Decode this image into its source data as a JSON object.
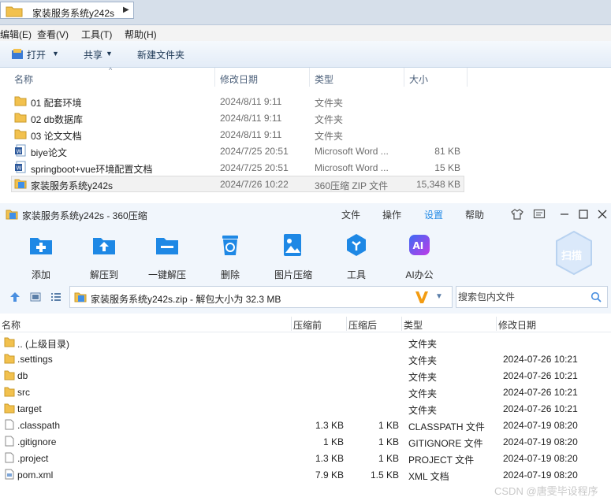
{
  "explorer": {
    "address": "家装服务系统y242s",
    "menu": [
      "编辑(E)",
      "查看(V)",
      "工具(T)",
      "帮助(H)"
    ],
    "toolbar": {
      "open": "打开",
      "share": "共享",
      "new_folder": "新建文件夹"
    },
    "columns": {
      "name": "名称",
      "date": "修改日期",
      "type": "类型",
      "size": "大小"
    },
    "rows": [
      {
        "name": "01 配套环境",
        "date": "2024/8/11 9:11",
        "type": "文件夹",
        "size": "",
        "icon": "folder-icon"
      },
      {
        "name": "02 db数据库",
        "date": "2024/8/11 9:11",
        "type": "文件夹",
        "size": "",
        "icon": "folder-icon"
      },
      {
        "name": "03 论文文档",
        "date": "2024/8/11 9:11",
        "type": "文件夹",
        "size": "",
        "icon": "folder-icon"
      },
      {
        "name": "biye论文",
        "date": "2024/7/25 20:51",
        "type": "Microsoft Word ...",
        "size": "81 KB",
        "icon": "word-icon"
      },
      {
        "name": "springboot+vue环境配置文档",
        "date": "2024/7/25 20:51",
        "type": "Microsoft Word ...",
        "size": "15 KB",
        "icon": "word-icon"
      },
      {
        "name": "家装服务系统y242s",
        "date": "2024/7/26 10:22",
        "type": "360压缩 ZIP 文件",
        "size": "15,348 KB",
        "icon": "zip-icon"
      }
    ]
  },
  "zip": {
    "title": "家装服务系统y242s - 360压缩",
    "menu": [
      "文件",
      "操作",
      "设置",
      "帮助"
    ],
    "active_menu": "设置",
    "ribbon": [
      "添加",
      "解压到",
      "一键解压",
      "删除",
      "图片压缩",
      "工具",
      "AI办公"
    ],
    "scan": "扫描",
    "path": "家装服务系统y242s.zip - 解包大小为 32.3 MB",
    "search_placeholder": "搜索包内文件",
    "columns": {
      "name": "名称",
      "compressed_before": "压缩前",
      "compressed_after": "压缩后",
      "type": "类型",
      "date": "修改日期"
    },
    "rows": [
      {
        "name": ".. (上级目录)",
        "before": "",
        "after": "",
        "type": "文件夹",
        "date": "",
        "icon": "folder-icon"
      },
      {
        "name": ".settings",
        "before": "",
        "after": "",
        "type": "文件夹",
        "date": "2024-07-26 10:21",
        "icon": "folder-icon"
      },
      {
        "name": "db",
        "before": "",
        "after": "",
        "type": "文件夹",
        "date": "2024-07-26 10:21",
        "icon": "folder-icon"
      },
      {
        "name": "src",
        "before": "",
        "after": "",
        "type": "文件夹",
        "date": "2024-07-26 10:21",
        "icon": "folder-icon"
      },
      {
        "name": "target",
        "before": "",
        "after": "",
        "type": "文件夹",
        "date": "2024-07-26 10:21",
        "icon": "folder-icon"
      },
      {
        "name": ".classpath",
        "before": "1.3 KB",
        "after": "1 KB",
        "type": "CLASSPATH 文件",
        "date": "2024-07-19 08:20",
        "icon": "file-icon"
      },
      {
        "name": ".gitignore",
        "before": "1 KB",
        "after": "1 KB",
        "type": "GITIGNORE 文件",
        "date": "2024-07-19 08:20",
        "icon": "file-icon"
      },
      {
        "name": ".project",
        "before": "1.3 KB",
        "after": "1 KB",
        "type": "PROJECT 文件",
        "date": "2024-07-19 08:20",
        "icon": "file-icon"
      },
      {
        "name": "pom.xml",
        "before": "7.9 KB",
        "after": "1.5 KB",
        "type": "XML 文档",
        "date": "2024-07-19 08:20",
        "icon": "xml-icon"
      }
    ]
  },
  "watermark": "CSDN @唐雯毕设程序",
  "colors": {
    "accent": "#1e88e5",
    "folder": "#f2c14e",
    "active_menu": "#1e88e5"
  }
}
